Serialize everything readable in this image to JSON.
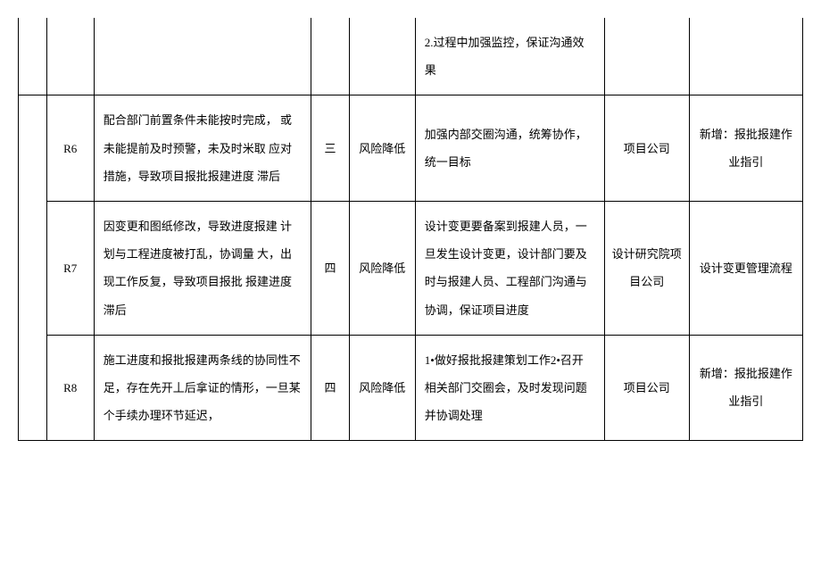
{
  "rows": [
    {
      "id": "",
      "description": "",
      "level": "",
      "strategy": "",
      "measures": "2.过程中加强监控，保证沟通效果",
      "department": "",
      "note": ""
    },
    {
      "id": "R6",
      "description": "配合部门前置条件未能按时完成，  或未能提前及时预警，未及时米取 应对措施，导致项目报批报建进度  滞后",
      "level": "三",
      "strategy": "风险降低",
      "measures": "加强内部交圈沟通，统筹协作，统一目标",
      "department": "项目公司",
      "note": "新增：报批报建作业指引"
    },
    {
      "id": "R7",
      "description": "因变更和图纸修改，导致进度报建 计划与工程进度被打乱，协调量 大，出现工作反复，导致项目报批 报建进度滞后",
      "level": "四",
      "strategy": "风险降低",
      "measures": "设计变更要备案到报建人员，一旦发生设计变更，设计部门要及时与报建人员、工程部门沟通与协调，保证项目进度",
      "department": "设计研究院项目公司",
      "note": "设计变更管理流程"
    },
    {
      "id": "R8",
      "description": "施工进度和报批报建两条线的协同性不足，存在先开丄后拿证的情形，一旦某个手续办理环节延迟，",
      "level": "四",
      "strategy": "风险降低",
      "measures": "1•做好报批报建策划工作2•召开相关部门交圈会，及时发现问题并协调处理",
      "department": "项目公司",
      "note": "新增：报批报建作业指引"
    }
  ]
}
